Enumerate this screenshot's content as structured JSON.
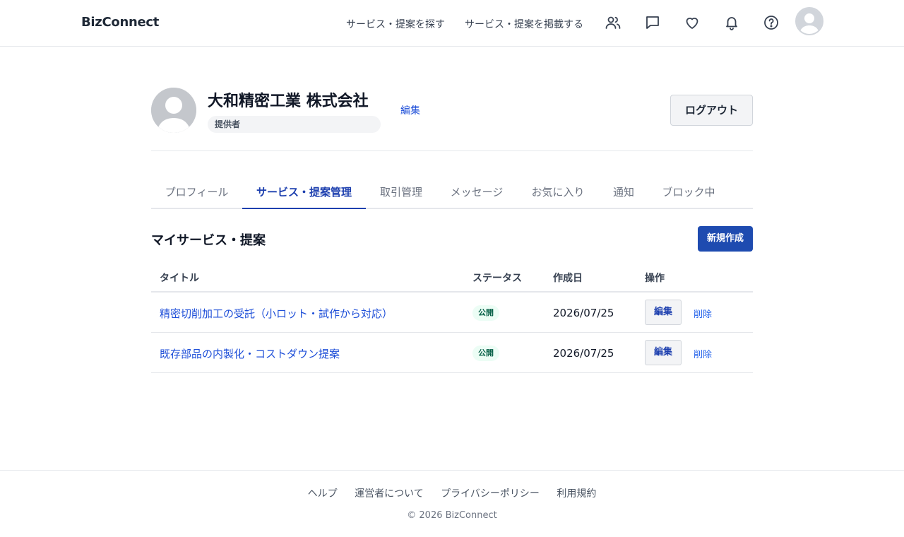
{
  "header": {
    "logo": "BizConnect",
    "nav": {
      "find": "サービス・提案を探す",
      "post": "サービス・提案を掲載する"
    },
    "icons": [
      "users-icon",
      "message-icon",
      "heart-icon",
      "bell-icon",
      "help-icon"
    ]
  },
  "profile": {
    "company_name": "大和精密工業 株式会社",
    "role": "提供者",
    "edit_label": "編集",
    "logout_label": "ログアウト"
  },
  "tabs": [
    {
      "label": "プロフィール",
      "active": false
    },
    {
      "label": "サービス・提案管理",
      "active": true
    },
    {
      "label": "取引管理",
      "active": false
    },
    {
      "label": "メッセージ",
      "active": false
    },
    {
      "label": "お気に入り",
      "active": false
    },
    {
      "label": "通知",
      "active": false
    },
    {
      "label": "ブロック中",
      "active": false
    }
  ],
  "section": {
    "title": "マイサービス・提案",
    "new_label": "新規作成"
  },
  "table": {
    "headers": {
      "title": "タイトル",
      "status": "ステータス",
      "date": "作成日",
      "ops": "操作"
    },
    "rows": [
      {
        "title": "精密切削加工の受託（小ロット・試作から対応）",
        "status": "公開",
        "date": "2026/07/25",
        "edit": "編集",
        "delete": "削除"
      },
      {
        "title": "既存部品の内製化・コストダウン提案",
        "status": "公開",
        "date": "2026/07/25",
        "edit": "編集",
        "delete": "削除"
      }
    ]
  },
  "footer": {
    "links": [
      "ヘルプ",
      "運営者について",
      "プライバシーポリシー",
      "利用規約"
    ],
    "copyright": "© 2026 BizConnect"
  },
  "colors": {
    "accent": "#1e40af",
    "button_primary": "#1e4bb0",
    "link": "#1d4ed8",
    "status_bg": "#ecfdf5",
    "status_text": "#065f46"
  }
}
